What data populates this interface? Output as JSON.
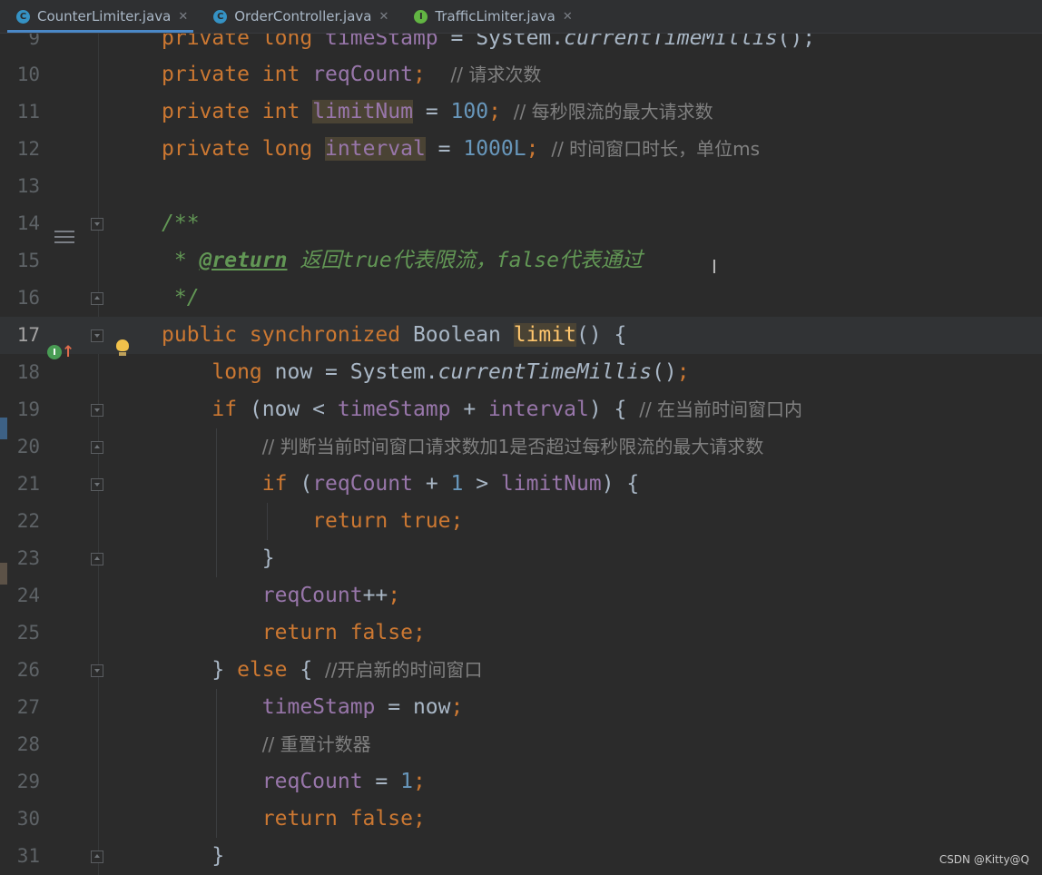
{
  "tabs": [
    {
      "label": "CounterLimiter.java",
      "icon": "class-icon",
      "active": true
    },
    {
      "label": "OrderController.java",
      "icon": "class-icon",
      "active": false
    },
    {
      "label": "TrafficLimiter.java",
      "icon": "interface-icon",
      "active": false
    }
  ],
  "gutter": {
    "line_numbers": [
      "9",
      "10",
      "11",
      "12",
      "13",
      "14",
      "15",
      "16",
      "17",
      "18",
      "19",
      "20",
      "21",
      "22",
      "23",
      "24",
      "25",
      "26",
      "27",
      "28",
      "29",
      "30",
      "31"
    ],
    "current_line": "17"
  },
  "code": {
    "l10_comment": "// 请求次数",
    "l11_comment": "// 每秒限流的最大请求数",
    "l12_comment": "// 时间窗口时长，单位ms",
    "l15_doc": "返回true代表限流，false代表通过",
    "l19_comment": "// 在当前时间窗口内",
    "l20_comment": "// 判断当前时间窗口请求数加1是否超过每秒限流的最大请求数",
    "l26_comment": "//开启新的时间窗口",
    "l28_comment": "// 重置计数器"
  },
  "watermark": "CSDN @Kitty@Q",
  "colors": {
    "background": "#2b2b2b",
    "keyword": "#cc7832",
    "field": "#9876aa",
    "number": "#6897bb",
    "comment": "#808080",
    "doc_comment": "#629755",
    "method": "#ffc66d"
  }
}
